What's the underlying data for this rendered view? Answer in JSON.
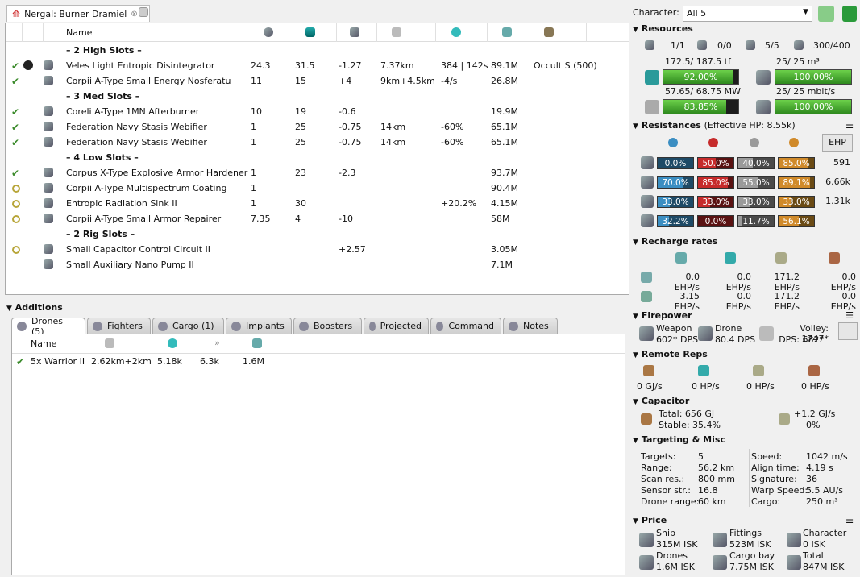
{
  "fit_tab": {
    "title": "Nergal: Burner Dramiel"
  },
  "columns": [
    "Name"
  ],
  "slots": [
    {
      "header": "– 2 High Slots –"
    },
    {
      "state": "online",
      "icon": "weapon-icon",
      "name": "Veles Light Entropic Disintegrator",
      "c1": "24.3",
      "c2": "31.5",
      "c3": "-1.27",
      "c4": "7.37km",
      "c5": "384 | 142s",
      "c6": "89.1M",
      "c7": "Occult S (500)"
    },
    {
      "state": "online",
      "icon": "nosferatu-icon",
      "name": "Corpii A-Type Small Energy Nosferatu",
      "c1": "11",
      "c2": "15",
      "c3": "+4",
      "c4": "9km+4.5km",
      "c5": "-4/s",
      "c6": "26.8M",
      "c7": ""
    },
    {
      "header": "– 3 Med Slots –"
    },
    {
      "state": "online",
      "icon": "afterburner-icon",
      "name": "Coreli A-Type 1MN Afterburner",
      "c1": "10",
      "c2": "19",
      "c3": "-0.6",
      "c4": "",
      "c5": "",
      "c6": "19.9M",
      "c7": ""
    },
    {
      "state": "online",
      "icon": "webifier-icon",
      "name": "Federation Navy Stasis Webifier",
      "c1": "1",
      "c2": "25",
      "c3": "-0.75",
      "c4": "14km",
      "c5": "-60%",
      "c6": "65.1M",
      "c7": ""
    },
    {
      "state": "online",
      "icon": "webifier-icon",
      "name": "Federation Navy Stasis Webifier",
      "c1": "1",
      "c2": "25",
      "c3": "-0.75",
      "c4": "14km",
      "c5": "-60%",
      "c6": "65.1M",
      "c7": ""
    },
    {
      "header": "– 4 Low Slots –"
    },
    {
      "state": "online",
      "icon": "hardener-icon",
      "name": "Corpus X-Type Explosive Armor Hardener",
      "c1": "1",
      "c2": "23",
      "c3": "-2.3",
      "c4": "",
      "c5": "",
      "c6": "93.7M",
      "c7": ""
    },
    {
      "state": "offline",
      "icon": "coating-icon",
      "name": "Corpii A-Type Multispectrum Coating",
      "c1": "1",
      "c2": "",
      "c3": "",
      "c4": "",
      "c5": "",
      "c6": "90.4M",
      "c7": ""
    },
    {
      "state": "offline",
      "icon": "heatsink-icon",
      "name": "Entropic Radiation Sink II",
      "c1": "1",
      "c2": "30",
      "c3": "",
      "c4": "",
      "c5": "+20.2%",
      "c6": "4.15M",
      "c7": ""
    },
    {
      "state": "offline",
      "icon": "repairer-icon",
      "name": "Corpii A-Type Small Armor Repairer",
      "c1": "7.35",
      "c2": "4",
      "c3": "-10",
      "c4": "",
      "c5": "",
      "c6": "58M",
      "c7": ""
    },
    {
      "header": "– 2 Rig Slots –"
    },
    {
      "state": "offline",
      "icon": "rig-icon",
      "name": "Small Capacitor Control Circuit II",
      "c1": "",
      "c2": "",
      "c3": "+2.57",
      "c4": "",
      "c5": "",
      "c6": "3.05M",
      "c7": ""
    },
    {
      "state": "none",
      "icon": "rig-icon",
      "name": "Small Auxiliary Nano Pump II",
      "c1": "",
      "c2": "",
      "c3": "",
      "c4": "",
      "c5": "",
      "c6": "7.1M",
      "c7": ""
    }
  ],
  "additions": {
    "title": "Additions",
    "tabs": [
      "Drones (5)",
      "Fighters",
      "Cargo (1)",
      "Implants",
      "Boosters",
      "Projected",
      "Command",
      "Notes"
    ],
    "drone_columns": [
      "Name"
    ],
    "drones": [
      {
        "name": "5x Warrior II",
        "range": "2.62km+2km",
        "v1": "5.18k",
        "v2": "6.3k",
        "price": "1.6M"
      }
    ]
  },
  "character": {
    "label": "Character:",
    "selected": "All 5"
  },
  "resources": {
    "title": "Resources",
    "counts": [
      "1/1",
      "0/0",
      "5/5",
      "300/400"
    ],
    "cpu_text": "172.5/ 187.5 tf",
    "cpu_pct": "92.00%",
    "cpu_value": 0.92,
    "drone_bay_text": "25/ 25 m³",
    "drone_bay_pct": "100.00%",
    "drone_bay_value": 1.0,
    "pg_text": "57.65/ 68.75 MW",
    "pg_pct": "83.85%",
    "pg_value": 0.8385,
    "bandwidth_text": "25/ 25 mbit/s",
    "bandwidth_pct": "100.00%",
    "bandwidth_value": 1.0
  },
  "resistances": {
    "title": "Resistances",
    "ehp_label": "(Effective HP: 8.55k)",
    "ehp_button": "EHP",
    "rows": [
      {
        "vals": [
          "0.0%",
          "50.0%",
          "40.0%",
          "85.0%"
        ],
        "fr": [
          0.0,
          0.5,
          0.4,
          0.85
        ],
        "hp": "591"
      },
      {
        "vals": [
          "70.0%",
          "85.0%",
          "55.0%",
          "89.1%"
        ],
        "fr": [
          0.7,
          0.85,
          0.55,
          0.891
        ],
        "hp": "6.66k"
      },
      {
        "vals": [
          "33.0%",
          "33.0%",
          "33.0%",
          "33.0%"
        ],
        "fr": [
          0.33,
          0.33,
          0.33,
          0.33
        ],
        "hp": "1.31k"
      },
      {
        "vals": [
          "32.2%",
          "0.0%",
          "11.7%",
          "56.1%"
        ],
        "fr": [
          0.322,
          0.0,
          0.117,
          0.561
        ],
        "hp": ""
      }
    ]
  },
  "recharge": {
    "title": "Recharge rates",
    "row1": [
      "0.0 EHP/s",
      "0.0 EHP/s",
      "171.2 EHP/s",
      "0.0 EHP/s"
    ],
    "row2": [
      "3.15 EHP/s",
      "0.0 EHP/s",
      "171.2 EHP/s",
      "0.0 EHP/s"
    ]
  },
  "firepower": {
    "title": "Firepower",
    "weapon_label": "Weapon",
    "weapon_dps": "602* DPS",
    "drone_label": "Drone",
    "drone_dps": "80.4 DPS",
    "volley": "Volley: 1747*",
    "dps": "DPS: 682*"
  },
  "remote_reps": {
    "title": "Remote Reps",
    "vals": [
      "0 GJ/s",
      "0 HP/s",
      "0 HP/s",
      "0 HP/s"
    ]
  },
  "capacitor": {
    "title": "Capacitor",
    "total": "Total: 656 GJ",
    "stable": "Stable: 35.4%",
    "delta": "+1.2 GJ/s",
    "delta_pct": "0%"
  },
  "targeting": {
    "title": "Targeting & Misc",
    "left": [
      [
        "Targets:",
        "5"
      ],
      [
        "Range:",
        "56.2 km"
      ],
      [
        "Scan res.:",
        "800 mm"
      ],
      [
        "Sensor str.:",
        "16.8"
      ],
      [
        "Drone range:",
        "60 km"
      ]
    ],
    "right": [
      [
        "Speed:",
        "1042 m/s"
      ],
      [
        "Align time:",
        "4.19 s"
      ],
      [
        "Signature:",
        "36"
      ],
      [
        "Warp Speed:",
        "5.5 AU/s"
      ],
      [
        "Cargo:",
        "250 m³"
      ]
    ]
  },
  "price": {
    "title": "Price",
    "items": [
      [
        "Ship",
        "315M ISK"
      ],
      [
        "Fittings",
        "523M ISK"
      ],
      [
        "Character",
        "0 ISK"
      ],
      [
        "Drones",
        "1.6M ISK"
      ],
      [
        "Cargo bay",
        "7.75M ISK"
      ],
      [
        "Total",
        "847M ISK"
      ]
    ]
  }
}
